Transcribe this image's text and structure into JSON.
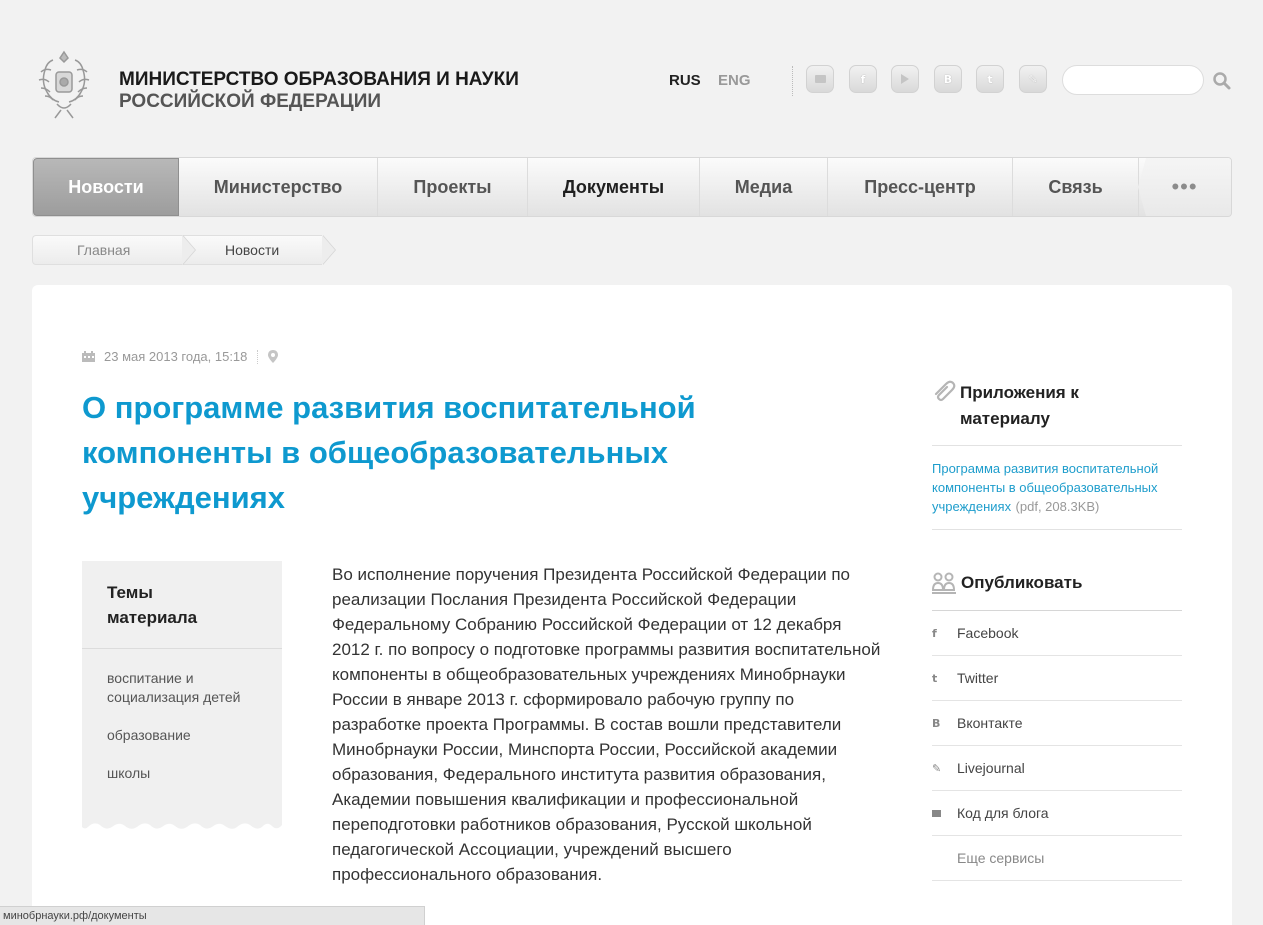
{
  "header": {
    "title_line1": "МИНИСТЕРСТВО ОБРАЗОВАНИЯ И НАУКИ",
    "title_line2": "РОССИЙСКОЙ ФЕДЕРАЦИИ",
    "lang_active": "RUS",
    "lang_other": "ENG",
    "social": [
      {
        "name": "chat-icon",
        "glyph": ""
      },
      {
        "name": "facebook-icon",
        "glyph": "f"
      },
      {
        "name": "youtube-icon",
        "glyph": ""
      },
      {
        "name": "vkontakte-icon",
        "glyph": "B"
      },
      {
        "name": "twitter-icon",
        "glyph": "t"
      },
      {
        "name": "livejournal-icon",
        "glyph": "✎"
      }
    ],
    "search": {
      "value": "",
      "placeholder": ""
    }
  },
  "nav": {
    "items": [
      "Новости",
      "Министерство",
      "Проекты",
      "Документы",
      "Медиа",
      "Пресс-центр",
      "Связь"
    ],
    "more": "•••"
  },
  "breadcrumb": {
    "home": "Главная",
    "current": "Новости"
  },
  "article": {
    "date": "23 мая 2013 года, 15:18",
    "title": "О программе развития воспитательной компоненты в общеобразовательных учреждениях",
    "body": "Во исполнение поручения Президента Российской Федерации по реализации Послания Президента Российской Федерации Федеральному Собранию Российской Федерации от 12 декабря 2012 г. по вопросу о подготовке программы развития воспитательной компоненты в общеобразовательных учреждениях Минобрнауки России в январе 2013 г. сформировало рабочую группу по разработке проекта Программы. В состав вошли представители Минобрнауки России, Минспорта России, Российской академии образования, Федерального института развития образования, Академии повышения квалификации и профессиональной переподготовки работников образования, Русской школьной педагогической Ассоциации, учреждений высшего профессионального образования."
  },
  "topics": {
    "heading": "Темы материала",
    "items": [
      "воспитание и социализация детей",
      "образование",
      "школы"
    ]
  },
  "sidebar": {
    "attachments_heading": "Приложения к материалу",
    "attachment_link": "Программа развития воспитательной компоненты в общеобразовательных учреждениях",
    "attachment_meta": "(pdf, 208.3KB)",
    "publish_heading": "Опубликовать",
    "publish_items": [
      "Facebook",
      "Twitter",
      "Вконтакте",
      "Livejournal",
      "Код для блога",
      "Еще сервисы"
    ]
  },
  "statusbar": "минобрнауки.рф/документы",
  "colors": {
    "accent": "#0e99cf",
    "link": "#1e9dcc",
    "nav_active": "#a8a8a8"
  }
}
